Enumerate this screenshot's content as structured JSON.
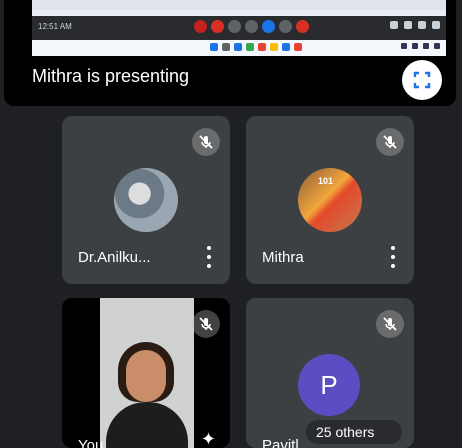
{
  "presentation": {
    "label": "Mithra is presenting",
    "shared_screen": {
      "time_text": "12:51 AM",
      "toolbar_dot_colors": [
        "#c5221f",
        "#d93025",
        "#5f6368",
        "#5f6368",
        "#1a73e8",
        "#5f6368",
        "#d93025"
      ],
      "taskbar_app_colors": [
        "#1a73e8",
        "#5f6368",
        "#1a73e8",
        "#34a853",
        "#ea4335",
        "#fbbc04",
        "#1a73e8",
        "#ea4335"
      ]
    }
  },
  "participants": [
    {
      "name": "Dr.Anilku...",
      "avatar_type": "photo",
      "muted": true
    },
    {
      "name": "Mithra",
      "avatar_type": "photo",
      "avatar_text": "101",
      "muted": true
    },
    {
      "name": "You",
      "avatar_type": "video",
      "muted": true
    },
    {
      "name": "Pavitl",
      "avatar_type": "letter",
      "avatar_letter": "P",
      "avatar_color": "#5b4ec2",
      "muted": true
    }
  ],
  "others_chip": {
    "label": "25 others"
  },
  "colors": {
    "background": "#1f2024",
    "tile": "#3c4043",
    "accent_avatar": "#5b4ec2"
  },
  "icons": [
    "mic-off-icon",
    "fullscreen-icon",
    "more-vert-icon",
    "sparkle-icon"
  ]
}
